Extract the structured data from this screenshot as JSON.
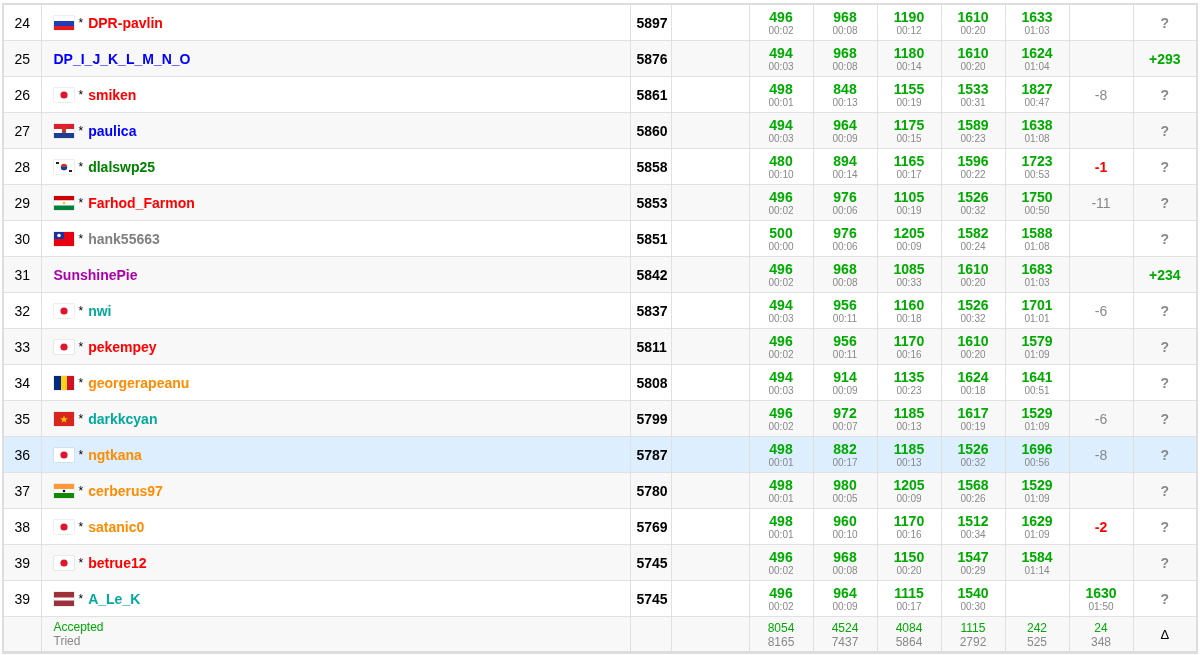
{
  "rows": [
    {
      "rank": "24",
      "flag": {
        "kind": "ru"
      },
      "mark": "*",
      "name": "DPR-pavlin",
      "color": "#ff0000",
      "highlighted": false,
      "points": "5897",
      "problems": [
        {
          "kind": "accepted",
          "score": "496",
          "time": "00:02"
        },
        {
          "kind": "accepted",
          "score": "968",
          "time": "00:08"
        },
        {
          "kind": "accepted",
          "score": "1190",
          "time": "00:12"
        },
        {
          "kind": "accepted",
          "score": "1610",
          "time": "00:20"
        },
        {
          "kind": "accepted",
          "score": "1633",
          "time": "01:03"
        },
        {
          "kind": "empty"
        }
      ],
      "hacks": {
        "kind": "unknown",
        "text": "?"
      }
    },
    {
      "rank": "25",
      "name": "DP_I_J_K_L_M_N_O",
      "color": "#0000ff",
      "highlighted": false,
      "points": "5876",
      "problems": [
        {
          "kind": "accepted",
          "score": "494",
          "time": "00:03"
        },
        {
          "kind": "accepted",
          "score": "968",
          "time": "00:08"
        },
        {
          "kind": "accepted",
          "score": "1180",
          "time": "00:14"
        },
        {
          "kind": "accepted",
          "score": "1610",
          "time": "00:20"
        },
        {
          "kind": "accepted",
          "score": "1624",
          "time": "01:04"
        },
        {
          "kind": "empty"
        }
      ],
      "hacks": {
        "kind": "gain",
        "text": "+293"
      }
    },
    {
      "rank": "26",
      "flag": {
        "kind": "jp"
      },
      "mark": "*",
      "name": "smiken",
      "color": "#ff0000",
      "highlighted": false,
      "points": "5861",
      "problems": [
        {
          "kind": "accepted",
          "score": "498",
          "time": "00:01"
        },
        {
          "kind": "accepted",
          "score": "848",
          "time": "00:13"
        },
        {
          "kind": "accepted",
          "score": "1155",
          "time": "00:19"
        },
        {
          "kind": "accepted",
          "score": "1533",
          "time": "00:31"
        },
        {
          "kind": "accepted",
          "score": "1827",
          "time": "00:47"
        },
        {
          "kind": "tried",
          "text": "-8"
        }
      ],
      "hacks": {
        "kind": "unknown",
        "text": "?"
      }
    },
    {
      "rank": "27",
      "flag": {
        "kind": "hr"
      },
      "mark": "*",
      "name": "paulica",
      "color": "#0000ff",
      "highlighted": false,
      "points": "5860",
      "problems": [
        {
          "kind": "accepted",
          "score": "494",
          "time": "00:03"
        },
        {
          "kind": "accepted",
          "score": "964",
          "time": "00:09"
        },
        {
          "kind": "accepted",
          "score": "1175",
          "time": "00:15"
        },
        {
          "kind": "accepted",
          "score": "1589",
          "time": "00:23"
        },
        {
          "kind": "accepted",
          "score": "1638",
          "time": "01:08"
        },
        {
          "kind": "empty"
        }
      ],
      "hacks": {
        "kind": "unknown",
        "text": "?"
      }
    },
    {
      "rank": "28",
      "flag": {
        "kind": "kr"
      },
      "mark": "*",
      "name": "dlalswp25",
      "color": "#008000",
      "highlighted": false,
      "points": "5858",
      "problems": [
        {
          "kind": "accepted",
          "score": "480",
          "time": "00:10"
        },
        {
          "kind": "accepted",
          "score": "894",
          "time": "00:14"
        },
        {
          "kind": "accepted",
          "score": "1165",
          "time": "00:17"
        },
        {
          "kind": "accepted",
          "score": "1596",
          "time": "00:22"
        },
        {
          "kind": "accepted",
          "score": "1723",
          "time": "00:53"
        },
        {
          "kind": "rejected",
          "text": "-1"
        }
      ],
      "hacks": {
        "kind": "unknown",
        "text": "?"
      }
    },
    {
      "rank": "29",
      "flag": {
        "kind": "tj"
      },
      "mark": "*",
      "name": "Farhod_Farmon",
      "color": "#ff0000",
      "highlighted": false,
      "points": "5853",
      "problems": [
        {
          "kind": "accepted",
          "score": "496",
          "time": "00:02"
        },
        {
          "kind": "accepted",
          "score": "976",
          "time": "00:06"
        },
        {
          "kind": "accepted",
          "score": "1105",
          "time": "00:19"
        },
        {
          "kind": "accepted",
          "score": "1526",
          "time": "00:32"
        },
        {
          "kind": "accepted",
          "score": "1750",
          "time": "00:50"
        },
        {
          "kind": "tried",
          "text": "-11"
        }
      ],
      "hacks": {
        "kind": "unknown",
        "text": "?"
      }
    },
    {
      "rank": "30",
      "flag": {
        "kind": "tw"
      },
      "mark": "*",
      "name": "hank55663",
      "color": "#808080",
      "highlighted": false,
      "points": "5851",
      "problems": [
        {
          "kind": "accepted",
          "score": "500",
          "time": "00:00"
        },
        {
          "kind": "accepted",
          "score": "976",
          "time": "00:06"
        },
        {
          "kind": "accepted",
          "score": "1205",
          "time": "00:09"
        },
        {
          "kind": "accepted",
          "score": "1582",
          "time": "00:24"
        },
        {
          "kind": "accepted",
          "score": "1588",
          "time": "01:08"
        },
        {
          "kind": "empty"
        }
      ],
      "hacks": {
        "kind": "unknown",
        "text": "?"
      }
    },
    {
      "rank": "31",
      "name": "SunshinePie",
      "color": "#aa00aa",
      "highlighted": false,
      "points": "5842",
      "problems": [
        {
          "kind": "accepted",
          "score": "496",
          "time": "00:02"
        },
        {
          "kind": "accepted",
          "score": "968",
          "time": "00:08"
        },
        {
          "kind": "accepted",
          "score": "1085",
          "time": "00:33"
        },
        {
          "kind": "accepted",
          "score": "1610",
          "time": "00:20"
        },
        {
          "kind": "accepted",
          "score": "1683",
          "time": "01:03"
        },
        {
          "kind": "empty"
        }
      ],
      "hacks": {
        "kind": "gain",
        "text": "+234"
      }
    },
    {
      "rank": "32",
      "flag": {
        "kind": "jp"
      },
      "mark": "*",
      "name": "nwi",
      "color": "#03a89e",
      "highlighted": false,
      "points": "5837",
      "problems": [
        {
          "kind": "accepted",
          "score": "494",
          "time": "00:03"
        },
        {
          "kind": "accepted",
          "score": "956",
          "time": "00:11"
        },
        {
          "kind": "accepted",
          "score": "1160",
          "time": "00:18"
        },
        {
          "kind": "accepted",
          "score": "1526",
          "time": "00:32"
        },
        {
          "kind": "accepted",
          "score": "1701",
          "time": "01:01"
        },
        {
          "kind": "tried",
          "text": "-6"
        }
      ],
      "hacks": {
        "kind": "unknown",
        "text": "?"
      }
    },
    {
      "rank": "33",
      "flag": {
        "kind": "jp"
      },
      "mark": "*",
      "name": "pekempey",
      "color": "#ff0000",
      "highlighted": false,
      "points": "5811",
      "problems": [
        {
          "kind": "accepted",
          "score": "496",
          "time": "00:02"
        },
        {
          "kind": "accepted",
          "score": "956",
          "time": "00:11"
        },
        {
          "kind": "accepted",
          "score": "1170",
          "time": "00:16"
        },
        {
          "kind": "accepted",
          "score": "1610",
          "time": "00:20"
        },
        {
          "kind": "accepted",
          "score": "1579",
          "time": "01:09"
        },
        {
          "kind": "empty"
        }
      ],
      "hacks": {
        "kind": "unknown",
        "text": "?"
      }
    },
    {
      "rank": "34",
      "flag": {
        "kind": "ro"
      },
      "mark": "*",
      "name": "georgerapeanu",
      "color": "#ff8c00",
      "highlighted": false,
      "points": "5808",
      "problems": [
        {
          "kind": "accepted",
          "score": "494",
          "time": "00:03"
        },
        {
          "kind": "accepted",
          "score": "914",
          "time": "00:09"
        },
        {
          "kind": "accepted",
          "score": "1135",
          "time": "00:23"
        },
        {
          "kind": "accepted",
          "score": "1624",
          "time": "00:18"
        },
        {
          "kind": "accepted",
          "score": "1641",
          "time": "00:51"
        },
        {
          "kind": "empty"
        }
      ],
      "hacks": {
        "kind": "unknown",
        "text": "?"
      }
    },
    {
      "rank": "35",
      "flag": {
        "kind": "vn"
      },
      "mark": "*",
      "name": "darkkcyan",
      "color": "#03a89e",
      "highlighted": false,
      "points": "5799",
      "problems": [
        {
          "kind": "accepted",
          "score": "496",
          "time": "00:02"
        },
        {
          "kind": "accepted",
          "score": "972",
          "time": "00:07"
        },
        {
          "kind": "accepted",
          "score": "1185",
          "time": "00:13"
        },
        {
          "kind": "accepted",
          "score": "1617",
          "time": "00:19"
        },
        {
          "kind": "accepted",
          "score": "1529",
          "time": "01:09"
        },
        {
          "kind": "tried",
          "text": "-6"
        }
      ],
      "hacks": {
        "kind": "unknown",
        "text": "?"
      }
    },
    {
      "rank": "36",
      "flag": {
        "kind": "jp"
      },
      "mark": "*",
      "name": "ngtkana",
      "color": "#ff8c00",
      "highlighted": true,
      "points": "5787",
      "problems": [
        {
          "kind": "accepted",
          "score": "498",
          "time": "00:01"
        },
        {
          "kind": "accepted",
          "score": "882",
          "time": "00:17"
        },
        {
          "kind": "accepted",
          "score": "1185",
          "time": "00:13"
        },
        {
          "kind": "accepted",
          "score": "1526",
          "time": "00:32"
        },
        {
          "kind": "accepted",
          "score": "1696",
          "time": "00:56"
        },
        {
          "kind": "tried",
          "text": "-8"
        }
      ],
      "hacks": {
        "kind": "unknown",
        "text": "?"
      }
    },
    {
      "rank": "37",
      "flag": {
        "kind": "in"
      },
      "mark": "*",
      "name": "cerberus97",
      "color": "#ff8c00",
      "highlighted": false,
      "points": "5780",
      "problems": [
        {
          "kind": "accepted",
          "score": "498",
          "time": "00:01"
        },
        {
          "kind": "accepted",
          "score": "980",
          "time": "00:05"
        },
        {
          "kind": "accepted",
          "score": "1205",
          "time": "00:09"
        },
        {
          "kind": "accepted",
          "score": "1568",
          "time": "00:26"
        },
        {
          "kind": "accepted",
          "score": "1529",
          "time": "01:09"
        },
        {
          "kind": "empty"
        }
      ],
      "hacks": {
        "kind": "unknown",
        "text": "?"
      }
    },
    {
      "rank": "38",
      "flag": {
        "kind": "jp"
      },
      "mark": "*",
      "name": "satanic0",
      "color": "#ff8c00",
      "highlighted": false,
      "points": "5769",
      "problems": [
        {
          "kind": "accepted",
          "score": "498",
          "time": "00:01"
        },
        {
          "kind": "accepted",
          "score": "960",
          "time": "00:10"
        },
        {
          "kind": "accepted",
          "score": "1170",
          "time": "00:16"
        },
        {
          "kind": "accepted",
          "score": "1512",
          "time": "00:34"
        },
        {
          "kind": "accepted",
          "score": "1629",
          "time": "01:09"
        },
        {
          "kind": "rejected",
          "text": "-2"
        }
      ],
      "hacks": {
        "kind": "unknown",
        "text": "?"
      }
    },
    {
      "rank": "39",
      "flag": {
        "kind": "jp"
      },
      "mark": "*",
      "name": "betrue12",
      "color": "#ff0000",
      "highlighted": false,
      "points": "5745",
      "problems": [
        {
          "kind": "accepted",
          "score": "496",
          "time": "00:02"
        },
        {
          "kind": "accepted",
          "score": "968",
          "time": "00:08"
        },
        {
          "kind": "accepted",
          "score": "1150",
          "time": "00:20"
        },
        {
          "kind": "accepted",
          "score": "1547",
          "time": "00:29"
        },
        {
          "kind": "accepted",
          "score": "1584",
          "time": "01:14"
        },
        {
          "kind": "empty"
        }
      ],
      "hacks": {
        "kind": "unknown",
        "text": "?"
      }
    },
    {
      "rank": "39",
      "flag": {
        "kind": "lv"
      },
      "mark": "*",
      "name": "A_Le_K",
      "color": "#03a89e",
      "highlighted": false,
      "points": "5745",
      "problems": [
        {
          "kind": "accepted",
          "score": "496",
          "time": "00:02"
        },
        {
          "kind": "accepted",
          "score": "964",
          "time": "00:09"
        },
        {
          "kind": "accepted",
          "score": "1115",
          "time": "00:17"
        },
        {
          "kind": "accepted",
          "score": "1540",
          "time": "00:30"
        },
        {
          "kind": "empty"
        },
        {
          "kind": "accepted",
          "score": "1630",
          "time": "01:50"
        }
      ],
      "hacks": {
        "kind": "unknown",
        "text": "?"
      }
    }
  ],
  "footer": {
    "accepted_label": "Accepted",
    "tried_label": "Tried",
    "problems": [
      {
        "accepted": "8054",
        "tried": "8165"
      },
      {
        "accepted": "4524",
        "tried": "7437"
      },
      {
        "accepted": "4084",
        "tried": "5864"
      },
      {
        "accepted": "1115",
        "tried": "2792"
      },
      {
        "accepted": "242",
        "tried": "525"
      },
      {
        "accepted": "24",
        "tried": "348"
      }
    ],
    "delta": "Δ"
  }
}
